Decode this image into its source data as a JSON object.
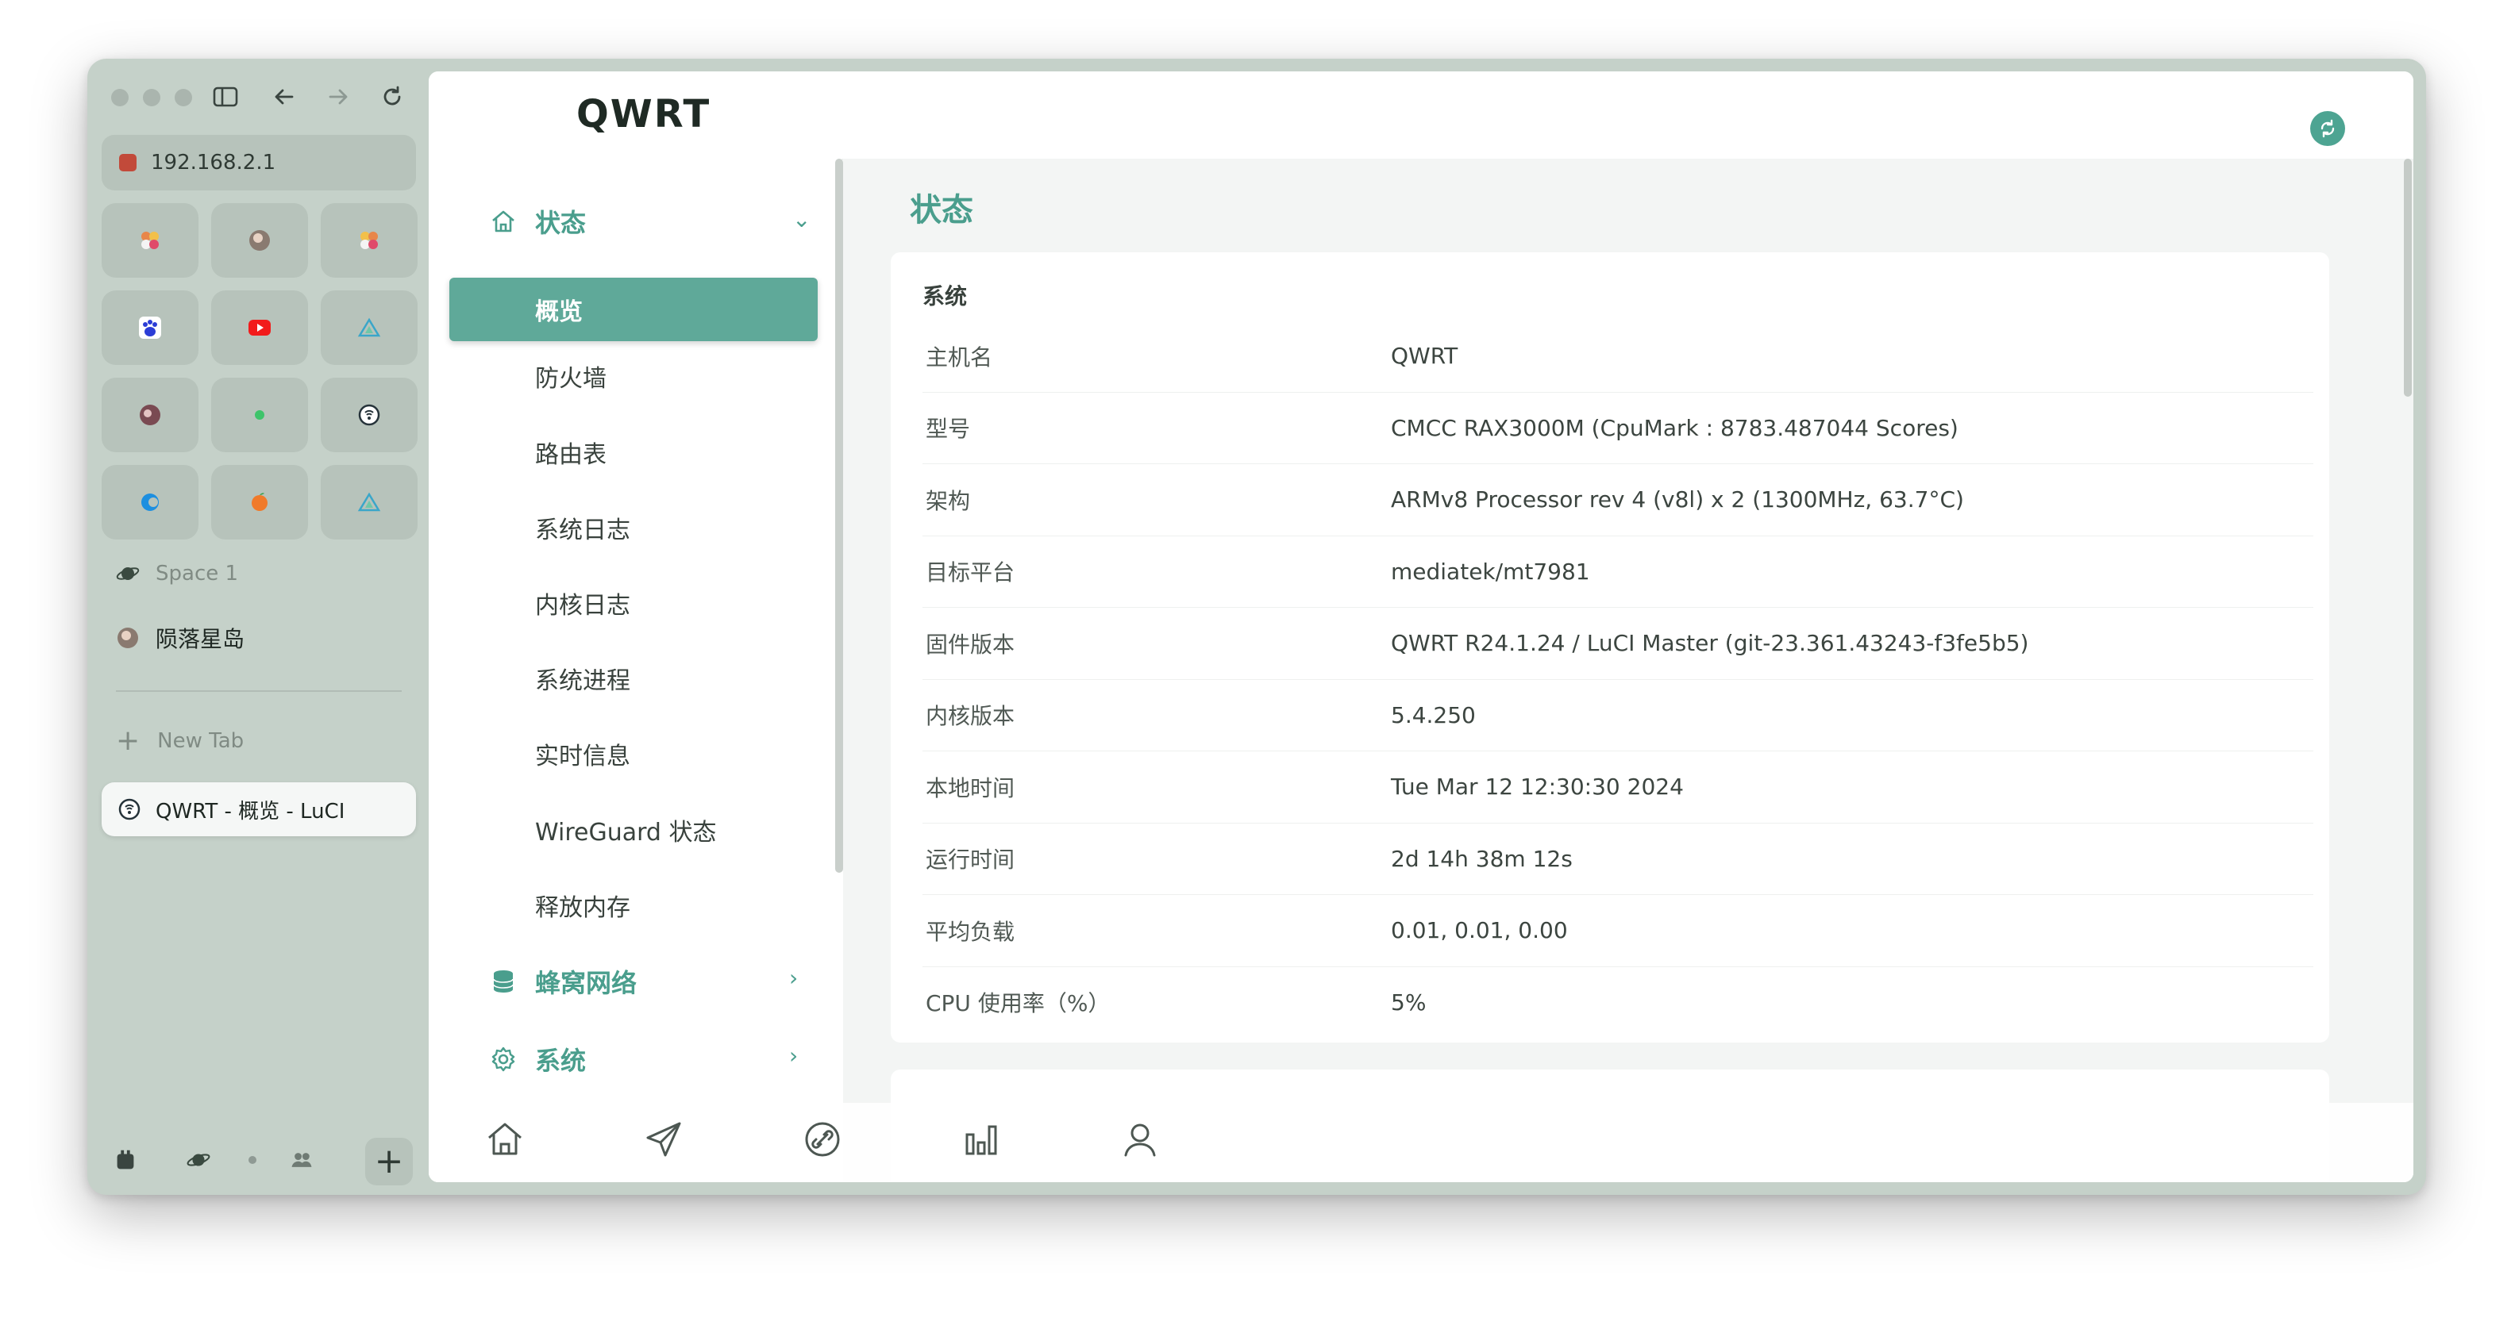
{
  "browser": {
    "url": "192.168.2.1",
    "favorites": [
      {
        "icon": "flower-icon"
      },
      {
        "icon": "avatar-icon"
      },
      {
        "icon": "flower-icon"
      },
      {
        "icon": "baidu-paw-icon"
      },
      {
        "icon": "youtube-icon"
      },
      {
        "icon": "triangle-logo-icon"
      },
      {
        "icon": "bird-icon"
      },
      {
        "icon": "green-dot-icon"
      },
      {
        "icon": "router-icon"
      },
      {
        "icon": "edge-icon"
      },
      {
        "icon": "orange-icon"
      },
      {
        "icon": "triangle-logo-icon"
      }
    ],
    "space_label": "Space 1",
    "pinned_label": "陨落星岛",
    "new_tab_label": "New Tab",
    "active_tab_title": "QWRT - 概览 - LuCI"
  },
  "header": {
    "brand": "QWRT"
  },
  "nav": {
    "status_group": "状态",
    "items": [
      "概览",
      "防火墙",
      "路由表",
      "系统日志",
      "内核日志",
      "系统进程",
      "实时信息",
      "WireGuard 状态",
      "释放内存"
    ],
    "cellular_group": "蜂窝网络",
    "system_group": "系统"
  },
  "main": {
    "page_title": "状态",
    "card_title": "系统",
    "rows": [
      {
        "label": "主机名",
        "value": "QWRT"
      },
      {
        "label": "型号",
        "value": "CMCC RAX3000M (CpuMark : 8783.487044 Scores)"
      },
      {
        "label": "架构",
        "value": "ARMv8 Processor rev 4 (v8l) x 2 (1300MHz, 63.7°C)"
      },
      {
        "label": "目标平台",
        "value": "mediatek/mt7981"
      },
      {
        "label": "固件版本",
        "value": "QWRT R24.1.24 / LuCI Master (git-23.361.43243-f3fe5b5)"
      },
      {
        "label": "内核版本",
        "value": "5.4.250"
      },
      {
        "label": "本地时间",
        "value": "Tue Mar 12 12:30:30 2024"
      },
      {
        "label": "运行时间",
        "value": "2d 14h 38m 12s"
      },
      {
        "label": "平均负载",
        "value": "0.01, 0.01, 0.00"
      },
      {
        "label": "CPU 使用率（%）",
        "value": "5%"
      }
    ]
  },
  "colors": {
    "accent": "#4a9e8d",
    "active_item": "#5fa999",
    "sidebar_bg": "#c5d1c9"
  }
}
